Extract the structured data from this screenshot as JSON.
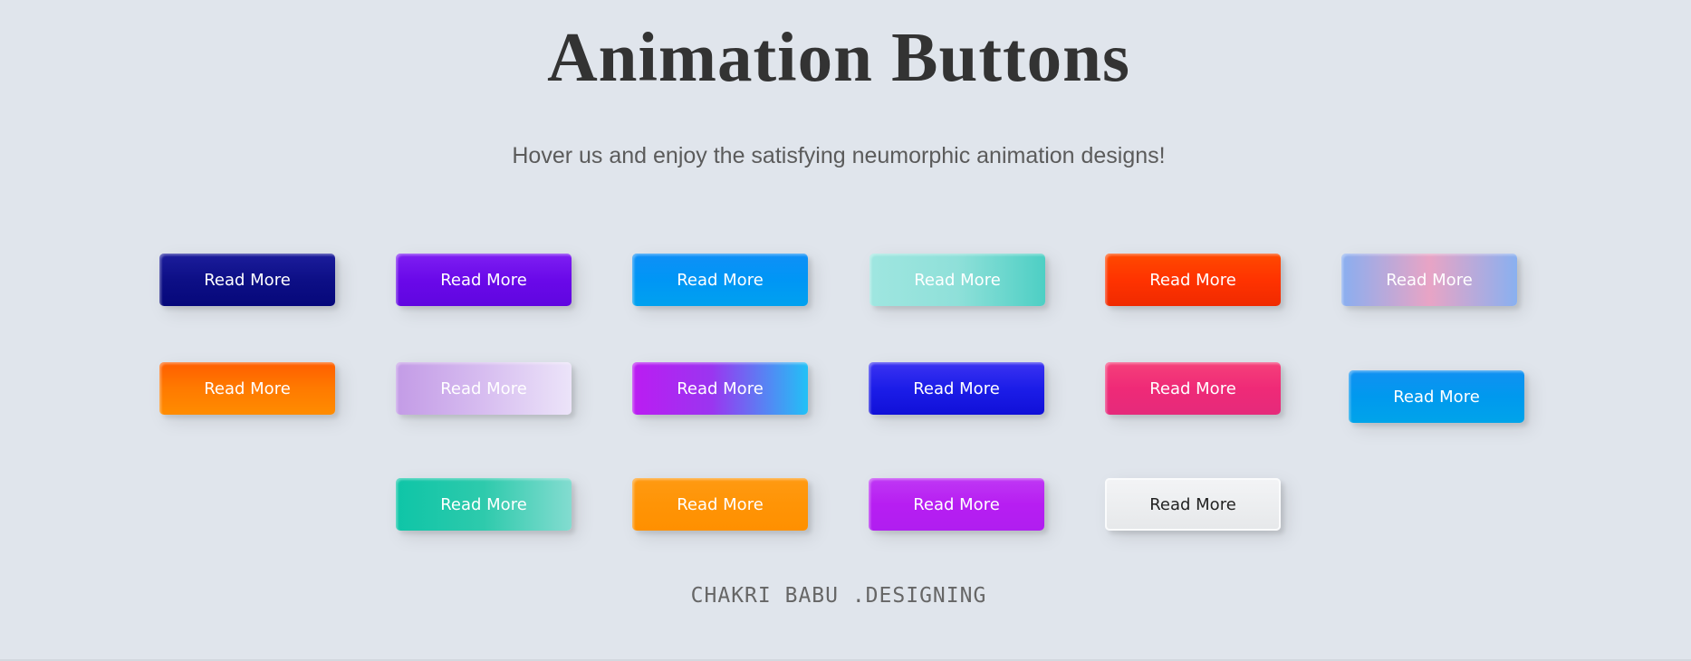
{
  "header": {
    "title": "Animation Buttons",
    "subtitle": "Hover us and enjoy the satisfying neumorphic animation designs!"
  },
  "buttons": [
    {
      "label": "Read More",
      "style": "dark-navy"
    },
    {
      "label": "Read More",
      "style": "violet"
    },
    {
      "label": "Read More",
      "style": "sky-blue"
    },
    {
      "label": "Read More",
      "style": "mint"
    },
    {
      "label": "Read More",
      "style": "red-orange"
    },
    {
      "label": "Read More",
      "style": "blue-pink"
    },
    {
      "label": "Read More",
      "style": "orange"
    },
    {
      "label": "Read More",
      "style": "lavender"
    },
    {
      "label": "Read More",
      "style": "purple-cyan"
    },
    {
      "label": "Read More",
      "style": "royal-blue"
    },
    {
      "label": "Read More",
      "style": "pink"
    },
    {
      "label": "Read More",
      "style": "azure"
    },
    {
      "label": "Read More",
      "style": "teal"
    },
    {
      "label": "Read More",
      "style": "amber"
    },
    {
      "label": "Read More",
      "style": "magenta"
    },
    {
      "label": "Read More",
      "style": "light-gray"
    }
  ],
  "colors": {
    "background": "#e0e5ec",
    "title": "#333333",
    "subtitle": "#5b5b5b",
    "footer": "#666666"
  },
  "footer": {
    "text": "CHAKRI BABU .DESIGNING"
  }
}
